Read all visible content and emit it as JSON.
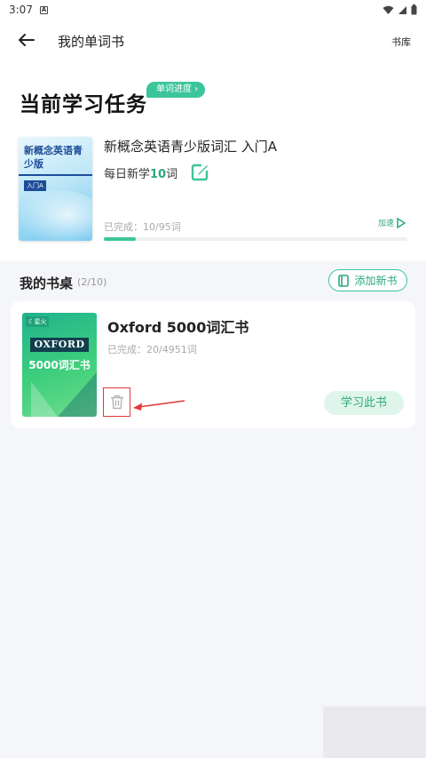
{
  "status_bar": {
    "time": "3:07",
    "a_icon": "A"
  },
  "header": {
    "title": "我的单词书",
    "library": "书库"
  },
  "current_task": {
    "title": "当前学习任务",
    "badge": "单词进度",
    "book": {
      "cover_title": "新概念英语青少版",
      "cover_tag": "入门A",
      "title": "新概念英语青少版词汇 入门A",
      "daily_prefix": "每日新学",
      "daily_num": "10",
      "daily_suffix": "词",
      "done": "已完成：10/95词",
      "speed": "加速",
      "progress": 0.105
    }
  },
  "desk": {
    "title": "我的书桌",
    "count": "(2/10)",
    "add_button": "添加新书",
    "books": [
      {
        "cover_logo": "ℰ 星火",
        "cover_brand": "OXFORD",
        "cover_title": "5000词汇书",
        "title": "Oxford 5000词汇书",
        "done": "已完成：20/4951词",
        "study_button": "学习此书"
      }
    ]
  },
  "colors": {
    "accent": "#3cc59a",
    "annotation": "#e53935"
  },
  "icons": [
    "back-arrow-icon",
    "edit-icon",
    "speed-icon",
    "add-book-icon",
    "trash-icon",
    "wifi-icon",
    "signal-icon",
    "battery-icon"
  ]
}
